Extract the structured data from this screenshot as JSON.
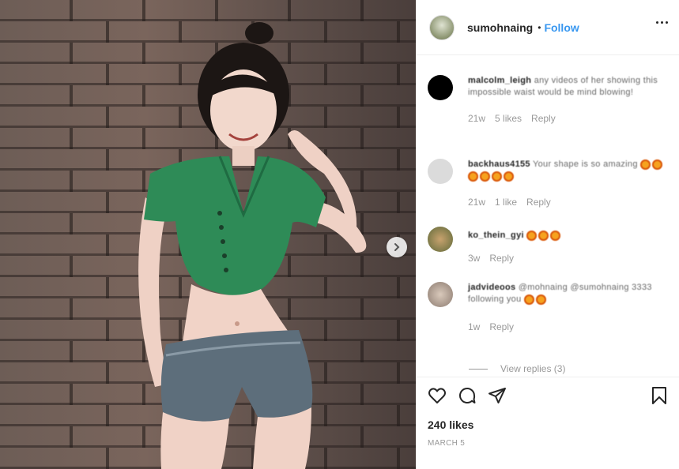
{
  "header": {
    "username": "sumohnaing",
    "separator": "•",
    "follow_label": "Follow"
  },
  "comments": [
    {
      "username": "malcolm_leigh",
      "text": "any videos of her showing this impossible waist would be mind blowing!",
      "age": "21w",
      "likes": "5 likes",
      "reply": "Reply"
    },
    {
      "username": "backhaus4155",
      "text": "Your shape is so amazing",
      "emoji_count": 6,
      "age": "21w",
      "likes": "1 like",
      "reply": "Reply"
    },
    {
      "username": "ko_thein_gyi",
      "text": "",
      "emoji_count": 3,
      "age": "3w",
      "reply": "Reply"
    },
    {
      "username": "jadvideoos",
      "text": "@mohnaing @sumohnaing 3333 following you",
      "emoji_count": 2,
      "age": "1w",
      "reply": "Reply",
      "view_replies": "View replies (3)"
    }
  ],
  "footer": {
    "likes": "240 likes",
    "date": "MARCH 5"
  },
  "colors": {
    "accent": "#3897f0",
    "muted": "#999999",
    "top_color": "#2e8b57"
  }
}
